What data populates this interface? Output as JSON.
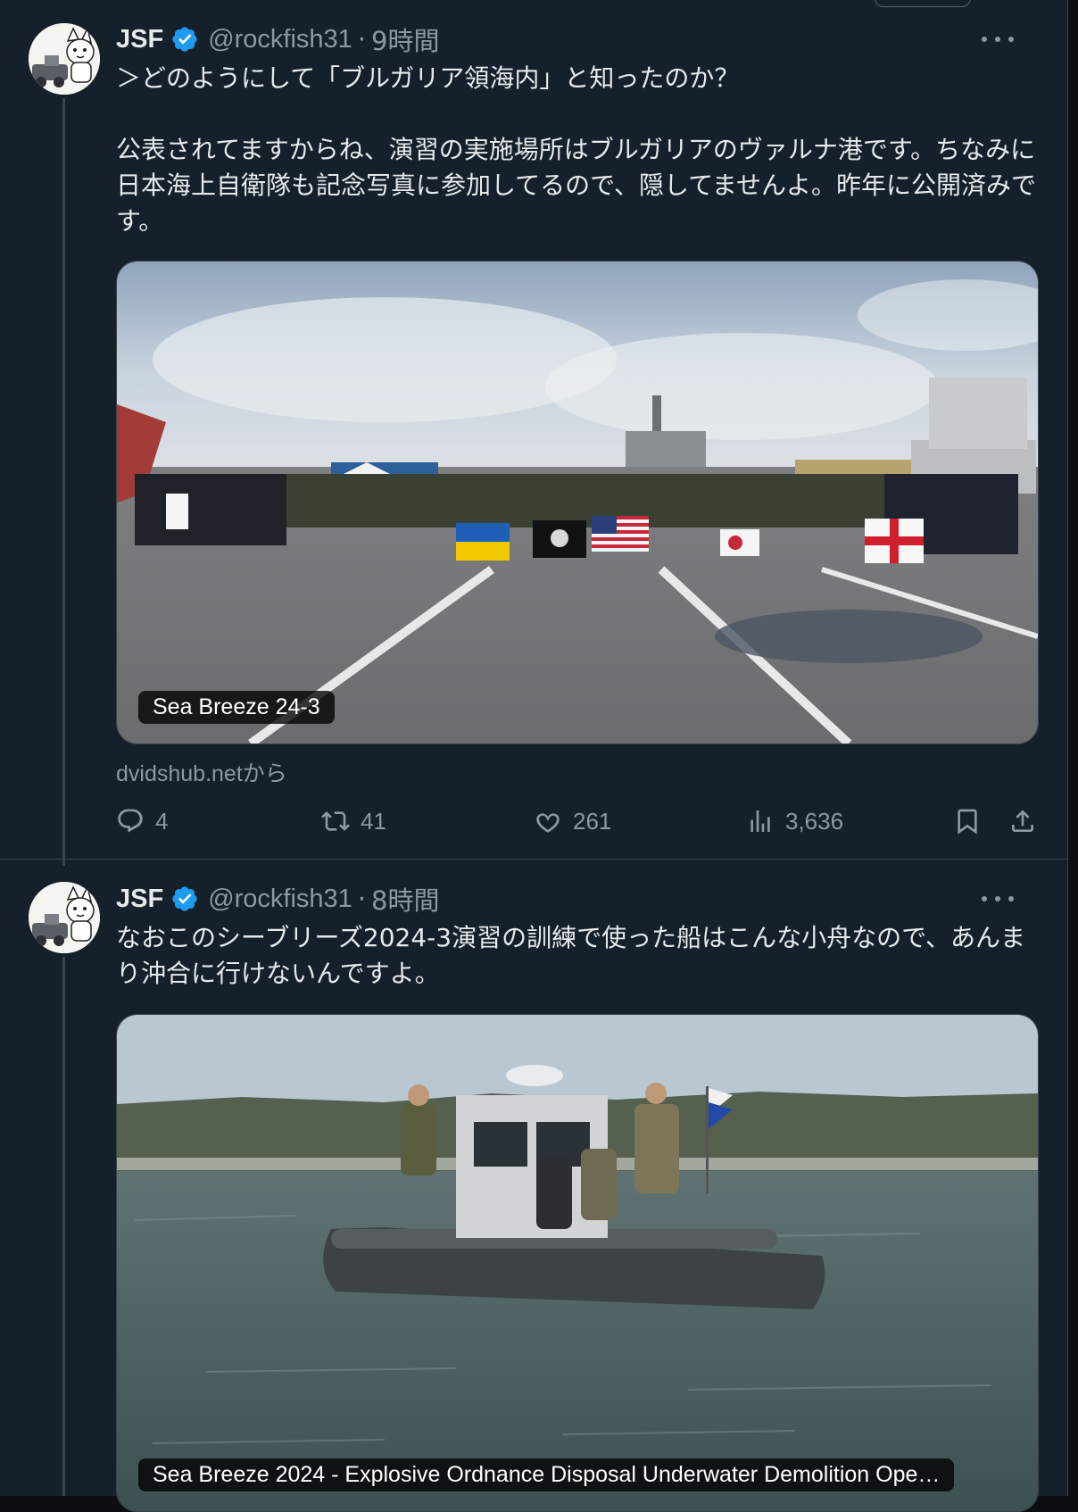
{
  "posts": [
    {
      "author": "JSF",
      "handle": "@rockfish31",
      "separator": "·",
      "time": "9時間",
      "text": "＞どのようにして「ブルガリア領海内」と知ったのか？\n\n公表されてますからね、演習の実施場所はブルガリアのヴァルナ港です。ちなみに日本海上自衛隊も記念写真に参加してるので、隠してませんよ。昨年に公開済みです。",
      "media_caption": "Sea Breeze 24-3",
      "source": "dvidshub.netから",
      "replies": "4",
      "reposts": "41",
      "likes": "261",
      "views": "3,636"
    },
    {
      "author": "JSF",
      "handle": "@rockfish31",
      "separator": "·",
      "time": "8時間",
      "text": "なおこのシーブリーズ2024-3演習の訓練で使った船はこんな小舟なので、あんまり沖合に行けないんですよ。",
      "media_caption": "Sea Breeze 2024 - Explosive Ordnance Disposal Underwater Demolition Ope…"
    }
  ],
  "icons": {
    "verified": "verified-badge-icon",
    "more": "more-icon",
    "reply": "reply-icon",
    "repost": "repost-icon",
    "like": "heart-icon",
    "views": "views-icon",
    "bookmark": "bookmark-icon",
    "share": "share-icon"
  },
  "colors": {
    "background": "#15202b",
    "text": "#e7e9ea",
    "secondary": "#8b98a5",
    "verified": "#1d9bf0",
    "border": "#38444d"
  }
}
